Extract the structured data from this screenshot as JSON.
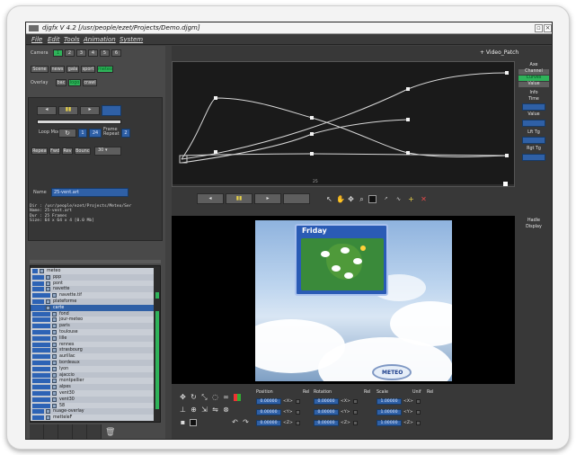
{
  "window": {
    "title": "djgfx V 4.2 [/usr/people/ezet/Projects/Demo.djgm]",
    "menu": [
      "File",
      "Edit",
      "Tools",
      "Animation",
      "System"
    ]
  },
  "left_panel": {
    "camera_label": "Camera",
    "camera_buttons": [
      "1",
      "2",
      "3",
      "4",
      "5",
      "6"
    ],
    "mode_buttons": [
      "Scene",
      "news",
      "gala",
      "sport",
      "meteo"
    ],
    "overlay_label": "Overlay",
    "overlay_buttons": [
      "bac",
      "logo",
      "crawl"
    ],
    "loop_mode_label": "Loop Mode",
    "loop_value": "1",
    "speed_value": "24",
    "frame_repeat_label": "Frame Repeat",
    "frame_repeat_value": "2",
    "repeat_buttons": [
      "Repeat",
      "Fwd",
      "Rev",
      "Bounce"
    ],
    "step_value": "30",
    "info_lines": [
      "Dir : /usr/people/ezet/Projects/Meteo/Ser",
      "Name: 25-vent.art",
      "Dur : 25 Frames",
      "Size: 64 x 64 x 4 [0.0 Mb]"
    ],
    "name_label": "Name",
    "name_value": "25-vent.art"
  },
  "tree": {
    "items": [
      {
        "indent": 0,
        "label": "meteo",
        "selected": false
      },
      {
        "indent": 1,
        "label": "ppp",
        "selected": false
      },
      {
        "indent": 1,
        "label": "pont",
        "selected": false
      },
      {
        "indent": 1,
        "label": "navette",
        "selected": false
      },
      {
        "indent": 2,
        "label": "navette.tif",
        "selected": false
      },
      {
        "indent": 1,
        "label": "plateforme",
        "selected": false
      },
      {
        "indent": 1,
        "label": "carte",
        "selected": true
      },
      {
        "indent": 2,
        "label": "fond",
        "selected": false
      },
      {
        "indent": 2,
        "label": "jour-meteo",
        "selected": false
      },
      {
        "indent": 2,
        "label": "paris",
        "selected": false
      },
      {
        "indent": 2,
        "label": "toulouse",
        "selected": false
      },
      {
        "indent": 2,
        "label": "lille",
        "selected": false
      },
      {
        "indent": 2,
        "label": "rennes",
        "selected": false
      },
      {
        "indent": 2,
        "label": "strasbourg",
        "selected": false
      },
      {
        "indent": 2,
        "label": "aurillac",
        "selected": false
      },
      {
        "indent": 2,
        "label": "bordeaux",
        "selected": false
      },
      {
        "indent": 2,
        "label": "lyon",
        "selected": false
      },
      {
        "indent": 2,
        "label": "ajaccio",
        "selected": false
      },
      {
        "indent": 2,
        "label": "montpellier",
        "selected": false
      },
      {
        "indent": 2,
        "label": "alpes",
        "selected": false
      },
      {
        "indent": 2,
        "label": "vent30",
        "selected": false
      },
      {
        "indent": 2,
        "label": "vent30",
        "selected": false
      },
      {
        "indent": 2,
        "label": "58",
        "selected": false
      },
      {
        "indent": 1,
        "label": "nuage-overlay",
        "selected": false
      },
      {
        "indent": 1,
        "label": "metteleF",
        "selected": false
      }
    ]
  },
  "curve_editor": {
    "title": "+ Video_Patch",
    "side_buttons": [
      "Axe",
      "Channel",
      "Curves",
      "Value",
      "Info",
      "Time",
      "Value",
      "Lft Tg",
      "Rgt Tg"
    ],
    "frame_label": "25"
  },
  "video": {
    "weather_day": "Friday",
    "logo_text": "METEO",
    "side_buttons": [
      "Hadle",
      "Display"
    ]
  },
  "transform": {
    "position_label": "Position",
    "rotation_label": "Rotation",
    "scale_label": "Scale",
    "rel_label": "Rel",
    "unif_label": "Unif",
    "position_values": [
      "0.00000",
      "0.00000",
      "0.00000"
    ],
    "rotation_values": [
      "0.00000",
      "0.00000",
      "0.00000"
    ],
    "scale_values": [
      "1.00000",
      "1.00000",
      "1.00000"
    ],
    "axis_buttons": [
      "<X>",
      "<Y>",
      "<Z>"
    ]
  },
  "colors": {
    "accent_green": "#2fb35a",
    "accent_blue": "#2f60a6",
    "panel_bg": "#494949"
  }
}
